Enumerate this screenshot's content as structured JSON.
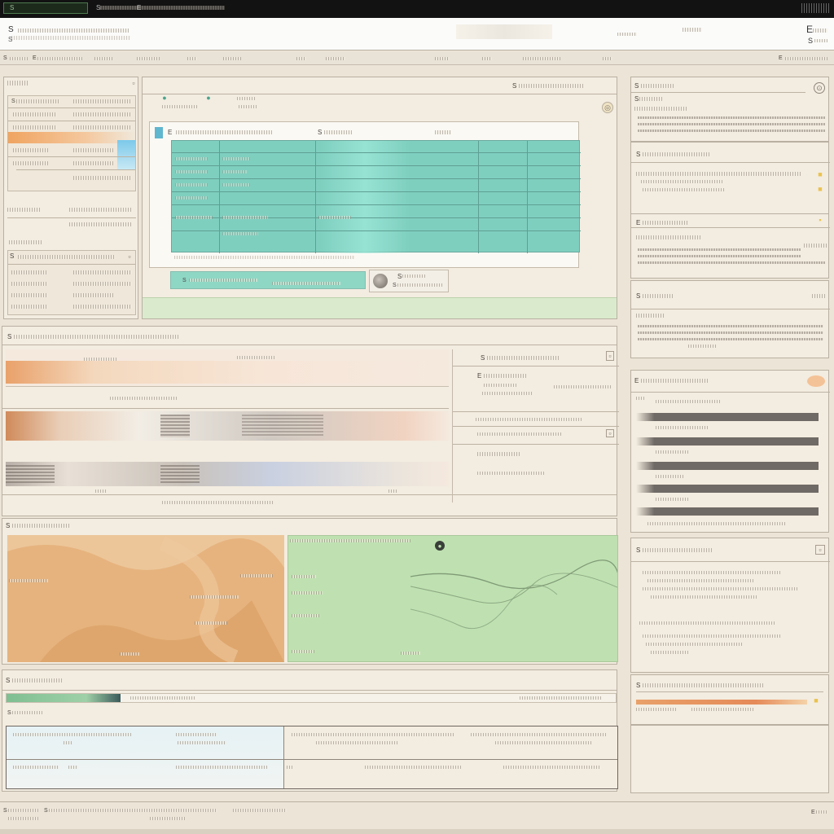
{
  "window": {
    "title": "S",
    "tabs": [
      "S",
      "E"
    ]
  },
  "header": {
    "title": "S",
    "subtitle": "S",
    "right_top": "E",
    "right_bottom": "S"
  },
  "toolbar": {
    "items": [
      "S",
      "E"
    ],
    "right": "E"
  },
  "left_panel": {
    "section_a_rows": [
      "S",
      "E"
    ],
    "section_b_title": "S"
  },
  "main_panel": {
    "header_label": "S",
    "table_title": "E",
    "table_col": "S",
    "footer_left": "S",
    "footer_card_title": "S",
    "footer_card_sub": "S"
  },
  "middle_panel": {
    "title": "S",
    "card_title": "S",
    "card_sub": "E"
  },
  "chart_strip": {
    "title": "S"
  },
  "bottom_panel": {
    "title": "S",
    "sub": "S"
  },
  "right_panel": {
    "box1_title": "S",
    "box1_sub": "S",
    "box2_title": "S",
    "box3_title": "E",
    "box4_title": "S",
    "box5_title": "E",
    "box6_title": "S",
    "box7_title": "S"
  },
  "footer": {
    "left": "S",
    "mid": "S",
    "right": "E"
  },
  "colors": {
    "teal": "#7fcfbf",
    "orange": "#e9a16a",
    "green": "#bfe1b1",
    "tan": "#e6b37e",
    "blue": "#4a8fd0"
  }
}
